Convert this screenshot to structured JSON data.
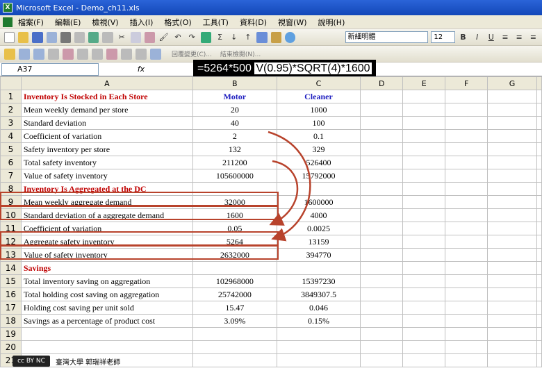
{
  "window": {
    "title": "Microsoft Excel - Demo_ch11.xls"
  },
  "menu": [
    "檔案(F)",
    "編輯(E)",
    "檢視(V)",
    "插入(I)",
    "格式(O)",
    "工具(T)",
    "資料(D)",
    "視窗(W)",
    "說明(H)"
  ],
  "toolbar": {
    "font": "新細明體",
    "size": "12"
  },
  "toolbar2": {
    "reply": "回覆變更(C)...",
    "end_review": "結束檢閱(N)..."
  },
  "formula": {
    "namebox": "A37",
    "fx": "fx",
    "overlay_pre": "=5264*500 ",
    "overlay_hl": "V(0.95)*SQRT(4)*1600"
  },
  "columns": [
    "A",
    "B",
    "C",
    "D",
    "E",
    "F",
    "G"
  ],
  "rows": [
    {
      "n": "1",
      "a": "Inventory Is Stocked in Each Store",
      "b": "Motor",
      "c": "Cleaner",
      "style": "header"
    },
    {
      "n": "2",
      "a": "Mean weekly demand per store",
      "b": "20",
      "c": "1000"
    },
    {
      "n": "3",
      "a": "Standard deviation",
      "b": "40",
      "c": "100"
    },
    {
      "n": "4",
      "a": "Coefficient of variation",
      "b": "2",
      "c": "0.1"
    },
    {
      "n": "5",
      "a": "Safety inventory per store",
      "b": "132",
      "c": "329"
    },
    {
      "n": "6",
      "a": "Total safety inventory",
      "b": "211200",
      "c": "526400"
    },
    {
      "n": "7",
      "a": "Value of safety inventory",
      "b": "105600000",
      "c": "15792000"
    },
    {
      "n": "8",
      "a": "Inventory Is Aggregated at the DC",
      "b": "",
      "c": "",
      "style": "section"
    },
    {
      "n": "9",
      "a": "Mean weekly aggregate demand",
      "b": "32000",
      "c": "1600000"
    },
    {
      "n": "10",
      "a": "Standard deviation of a aggregate demand",
      "b": "1600",
      "c": "4000"
    },
    {
      "n": "11",
      "a": "Coefficient of variation",
      "b": "0.05",
      "c": "0.0025"
    },
    {
      "n": "12",
      "a": "Aggregate safety inventory",
      "b": "5264",
      "c": "13159"
    },
    {
      "n": "13",
      "a": "Value of safety inventory",
      "b": "2632000",
      "c": "394770"
    },
    {
      "n": "14",
      "a": "Savings",
      "b": "",
      "c": "",
      "style": "section"
    },
    {
      "n": "15",
      "a": "Total inventory saving on aggregation",
      "b": "102968000",
      "c": "15397230"
    },
    {
      "n": "16",
      "a": "Total holding cost saving on aggregation",
      "b": "25742000",
      "c": "3849307.5"
    },
    {
      "n": "17",
      "a": "Holding cost saving per unit sold",
      "b": "15.47",
      "c": "0.046"
    },
    {
      "n": "18",
      "a": "Savings as a percentage of product cost",
      "b": "3.09%",
      "c": "0.15%"
    },
    {
      "n": "19",
      "a": "",
      "b": "",
      "c": ""
    },
    {
      "n": "20",
      "a": "",
      "b": "",
      "c": ""
    },
    {
      "n": "21",
      "a": "",
      "b": "",
      "c": ""
    }
  ],
  "footer": {
    "license": "cc BY NC SA",
    "credit": "臺灣大學 郭瑞祥老師"
  },
  "colors": {
    "accent": "#b8432c",
    "title_bar": "#1247b8"
  }
}
